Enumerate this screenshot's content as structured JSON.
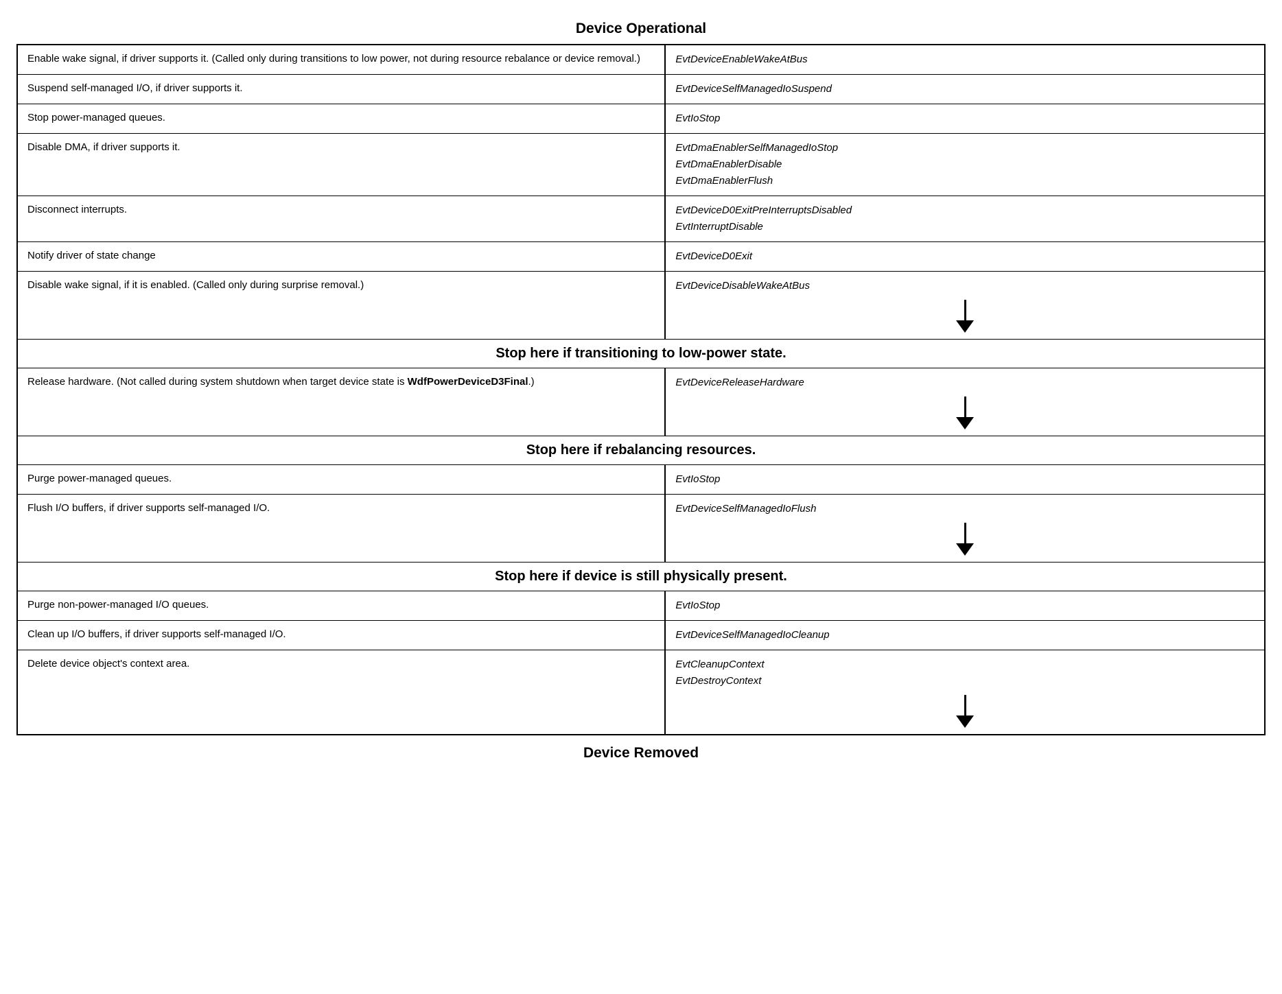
{
  "title": "Device Operational",
  "footer": "Device Removed",
  "rows_group1": [
    {
      "left": "Enable wake signal, if driver supports it. (Called only during transitions to low power, not during resource rebalance or device removal.)",
      "right": "EvtDeviceEnableWakeAtBus",
      "has_arrow": false
    },
    {
      "left": "Suspend self-managed I/O, if driver supports it.",
      "right": "EvtDeviceSelfManagedIoSuspend",
      "has_arrow": false
    },
    {
      "left": "Stop power-managed queues.",
      "right": "EvtIoStop",
      "has_arrow": false
    },
    {
      "left": "Disable DMA, if driver supports it.",
      "right": "EvtDmaEnablerSelfManagedIoStop\nEvtDmaEnablerDisable\nEvtDmaEnablerFlush",
      "has_arrow": false
    },
    {
      "left": "Disconnect interrupts.",
      "right": "EvtDeviceD0ExitPreInterruptsDisabled\nEvtInterruptDisable",
      "has_arrow": false
    },
    {
      "left": "Notify driver of state change",
      "right": "EvtDeviceD0Exit",
      "has_arrow": false
    },
    {
      "left": "Disable wake signal, if it is enabled. (Called only during surprise removal.)",
      "right": "EvtDeviceDisableWakeAtBus",
      "has_arrow": true
    }
  ],
  "stop1": "Stop here if transitioning to low-power state.",
  "rows_group2": [
    {
      "left": "Release hardware. (Not called during system shutdown when target device state is WdfPowerDeviceD3Final.)",
      "left_bold": "WdfPowerDeviceD3Final",
      "right": "EvtDeviceReleaseHardware",
      "has_arrow": true
    }
  ],
  "stop2": "Stop here if rebalancing resources.",
  "rows_group3": [
    {
      "left": "Purge power-managed queues.",
      "right": "EvtIoStop",
      "has_arrow": false
    },
    {
      "left": "Flush I/O buffers, if driver supports self-managed I/O.",
      "right": "EvtDeviceSelfManagedIoFlush",
      "has_arrow": true
    }
  ],
  "stop3": "Stop here if device is still physically present.",
  "rows_group4": [
    {
      "left": "Purge non-power-managed I/O queues.",
      "right": "EvtIoStop",
      "has_arrow": false
    },
    {
      "left": "Clean up I/O buffers, if driver supports self-managed I/O.",
      "right": "EvtDeviceSelfManagedIoCleanup",
      "has_arrow": false
    },
    {
      "left": "Delete device object's context area.",
      "right": "EvtCleanupContext\nEvtDestroyContext",
      "has_arrow": true
    }
  ]
}
